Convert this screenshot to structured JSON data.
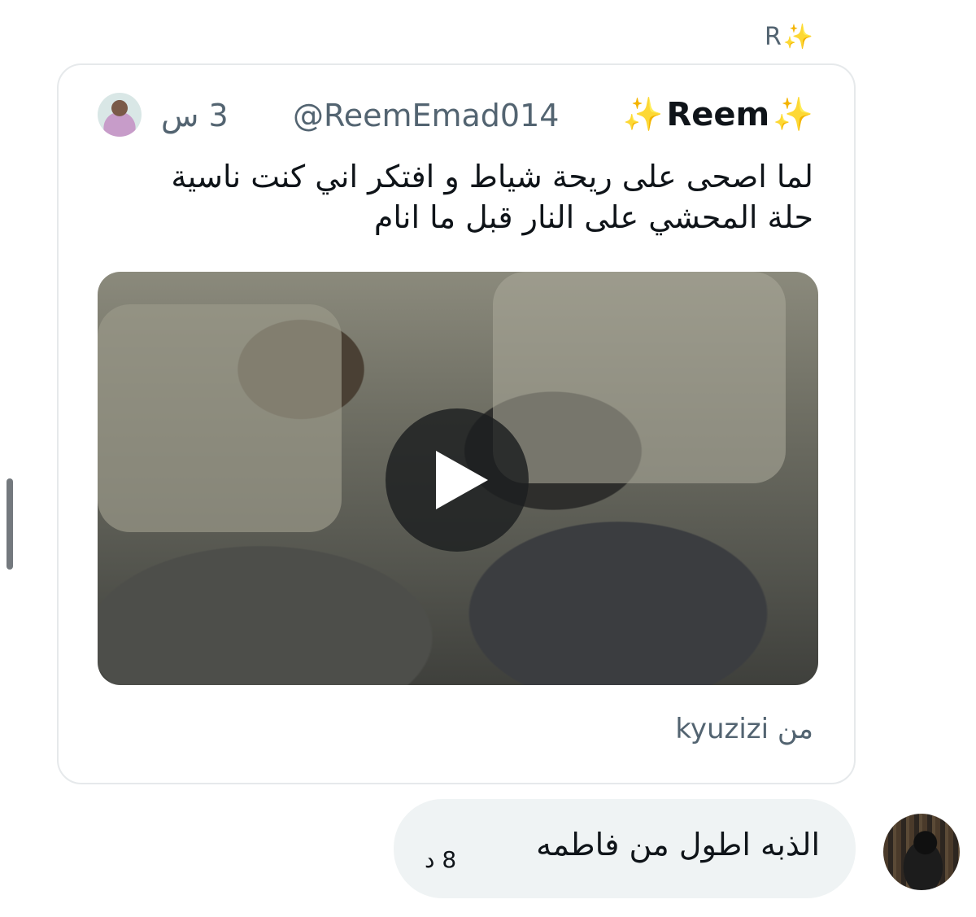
{
  "reply_label": {
    "text": "R",
    "sparkle": "✨"
  },
  "quoted_tweet": {
    "avatar_icon": "avatar-image",
    "display_name": "Reem",
    "sparkle": "✨",
    "handle": "@ReemEmad014",
    "time_ago": "3 س",
    "text_line1": "لما اصحى على ريحة شياط و افتكر اني كنت ناسية",
    "text_line2": "حلة المحشي على النار قبل ما انام",
    "media": {
      "type": "video",
      "play_icon": "play-icon"
    },
    "source": "من kyuzizi"
  },
  "message": {
    "text": "الذبه اطول من فاطمه",
    "time": "8 د",
    "sender_avatar_icon": "avatar-image"
  },
  "colors": {
    "secondary_text": "#536471",
    "bubble_bg": "#eff3f4",
    "border": "#e6e9eb",
    "sparkle": "#f5c518"
  }
}
